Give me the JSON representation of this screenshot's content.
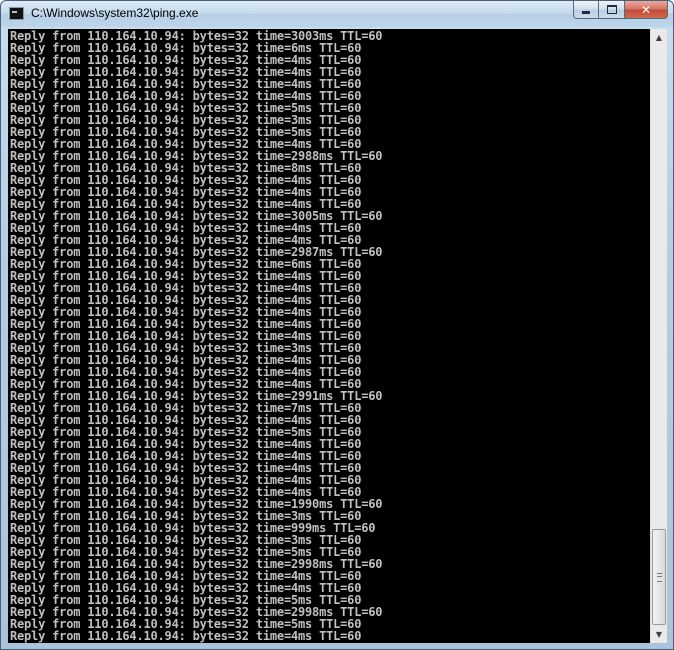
{
  "window": {
    "title": "C:\\Windows\\system32\\ping.exe",
    "close_label": "✕"
  },
  "console": {
    "lines": [
      "Reply from 110.164.10.94: bytes=32 time=3003ms TTL=60",
      "Reply from 110.164.10.94: bytes=32 time=6ms TTL=60",
      "Reply from 110.164.10.94: bytes=32 time=4ms TTL=60",
      "Reply from 110.164.10.94: bytes=32 time=4ms TTL=60",
      "Reply from 110.164.10.94: bytes=32 time=4ms TTL=60",
      "Reply from 110.164.10.94: bytes=32 time=4ms TTL=60",
      "Reply from 110.164.10.94: bytes=32 time=5ms TTL=60",
      "Reply from 110.164.10.94: bytes=32 time=3ms TTL=60",
      "Reply from 110.164.10.94: bytes=32 time=5ms TTL=60",
      "Reply from 110.164.10.94: bytes=32 time=4ms TTL=60",
      "Reply from 110.164.10.94: bytes=32 time=2988ms TTL=60",
      "Reply from 110.164.10.94: bytes=32 time=8ms TTL=60",
      "Reply from 110.164.10.94: bytes=32 time=4ms TTL=60",
      "Reply from 110.164.10.94: bytes=32 time=4ms TTL=60",
      "Reply from 110.164.10.94: bytes=32 time=4ms TTL=60",
      "Reply from 110.164.10.94: bytes=32 time=3005ms TTL=60",
      "Reply from 110.164.10.94: bytes=32 time=4ms TTL=60",
      "Reply from 110.164.10.94: bytes=32 time=4ms TTL=60",
      "Reply from 110.164.10.94: bytes=32 time=2987ms TTL=60",
      "Reply from 110.164.10.94: bytes=32 time=6ms TTL=60",
      "Reply from 110.164.10.94: bytes=32 time=4ms TTL=60",
      "Reply from 110.164.10.94: bytes=32 time=4ms TTL=60",
      "Reply from 110.164.10.94: bytes=32 time=4ms TTL=60",
      "Reply from 110.164.10.94: bytes=32 time=4ms TTL=60",
      "Reply from 110.164.10.94: bytes=32 time=4ms TTL=60",
      "Reply from 110.164.10.94: bytes=32 time=4ms TTL=60",
      "Reply from 110.164.10.94: bytes=32 time=3ms TTL=60",
      "Reply from 110.164.10.94: bytes=32 time=4ms TTL=60",
      "Reply from 110.164.10.94: bytes=32 time=4ms TTL=60",
      "Reply from 110.164.10.94: bytes=32 time=4ms TTL=60",
      "Reply from 110.164.10.94: bytes=32 time=2991ms TTL=60",
      "Reply from 110.164.10.94: bytes=32 time=7ms TTL=60",
      "Reply from 110.164.10.94: bytes=32 time=4ms TTL=60",
      "Reply from 110.164.10.94: bytes=32 time=5ms TTL=60",
      "Reply from 110.164.10.94: bytes=32 time=4ms TTL=60",
      "Reply from 110.164.10.94: bytes=32 time=4ms TTL=60",
      "Reply from 110.164.10.94: bytes=32 time=4ms TTL=60",
      "Reply from 110.164.10.94: bytes=32 time=4ms TTL=60",
      "Reply from 110.164.10.94: bytes=32 time=4ms TTL=60",
      "Reply from 110.164.10.94: bytes=32 time=1990ms TTL=60",
      "Reply from 110.164.10.94: bytes=32 time=3ms TTL=60",
      "Reply from 110.164.10.94: bytes=32 time=999ms TTL=60",
      "Reply from 110.164.10.94: bytes=32 time=3ms TTL=60",
      "Reply from 110.164.10.94: bytes=32 time=5ms TTL=60",
      "Reply from 110.164.10.94: bytes=32 time=2998ms TTL=60",
      "Reply from 110.164.10.94: bytes=32 time=4ms TTL=60",
      "Reply from 110.164.10.94: bytes=32 time=4ms TTL=60",
      "Reply from 110.164.10.94: bytes=32 time=5ms TTL=60",
      "Reply from 110.164.10.94: bytes=32 time=2998ms TTL=60",
      "Reply from 110.164.10.94: bytes=32 time=5ms TTL=60",
      "Reply from 110.164.10.94: bytes=32 time=4ms TTL=60"
    ]
  },
  "colors": {
    "console_background": "#000000",
    "console_text": "#c0c0c0"
  }
}
